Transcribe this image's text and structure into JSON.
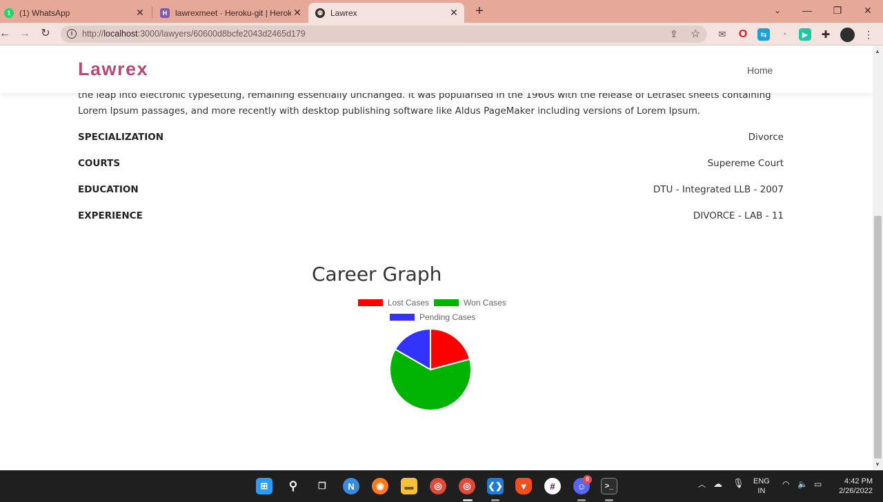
{
  "browser": {
    "tabs": [
      {
        "title": "(1) WhatsApp",
        "favicon": "whatsapp-icon"
      },
      {
        "title": "lawrexmeet · Heroku-git | Heroku",
        "favicon": "heroku-icon"
      },
      {
        "title": "Lawrex",
        "favicon": "globe-icon",
        "active": true
      }
    ],
    "url_prefix": "http://",
    "url_host": "localhost",
    "url_rest": ":3000/lawyers/60600d8bcfe2043d2465d179"
  },
  "site": {
    "brand": "Lawrex",
    "nav_home": "Home",
    "brand_color": "#b5497a"
  },
  "profile": {
    "description": "the leap into electronic typesetting, remaining essentially unchanged. It was popularised in the 1960s with the release of Letraset sheets containing Lorem Ipsum passages, and more recently with desktop publishing software like Aldus PageMaker including versions of Lorem Ipsum.",
    "rows": [
      {
        "label": "SPECIALIZATION",
        "value": "Divorce"
      },
      {
        "label": "COURTS",
        "value": "Supereme Court"
      },
      {
        "label": "EDUCATION",
        "value": "DTU - Integrated LLB - 2007"
      },
      {
        "label": "EXPERIENCE",
        "value": "DIVORCE - LAB - 11"
      }
    ]
  },
  "chart_data": {
    "type": "pie",
    "title": "Career Graph",
    "categories": [
      "Lost Cases",
      "Won Cases",
      "Pending Cases"
    ],
    "values": [
      2,
      6,
      1.6
    ],
    "colors": [
      "#ff0000",
      "#00b300",
      "#3333ff"
    ],
    "legend": "top"
  },
  "taskbar": {
    "lang_top": "ENG",
    "lang_bottom": "IN",
    "time": "4:42 PM",
    "date": "2/26/2022",
    "discord_badge": "8"
  }
}
